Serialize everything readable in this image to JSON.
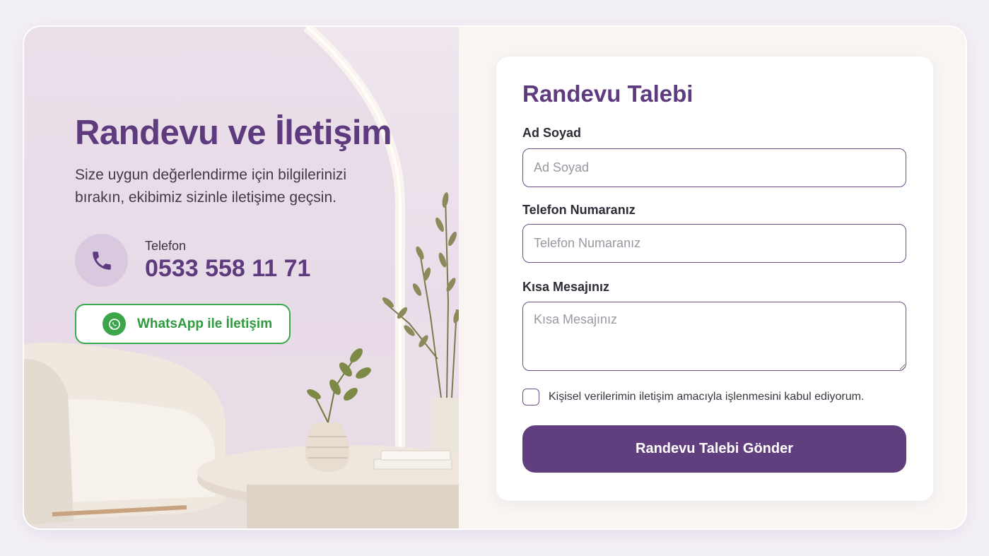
{
  "left_panel": {
    "headline": "Randevu ve İletişim",
    "subtitle": "Size uygun değerlendirme için bilgilerinizi bırakın, ekibimiz sizinle iletişime geçsin.",
    "phone": {
      "icon": "phone-icon",
      "label": "Telefon",
      "number": "0533 558 11 71"
    },
    "whatsapp_button": {
      "icon": "whatsapp-icon",
      "label": "WhatsApp ile İletişim"
    }
  },
  "form": {
    "title": "Randevu Talebi",
    "fields": [
      {
        "label": "Ad Soyad",
        "placeholder": "Ad Soyad",
        "value": ""
      },
      {
        "label": "Telefon Numaranız",
        "placeholder": "Telefon Numaranız",
        "value": ""
      },
      {
        "label": "Kısa Mesajınız",
        "placeholder": "Kısa Mesajınız",
        "value": ""
      }
    ],
    "consent": {
      "checked": false,
      "text": "Kişisel verilerimin iletişim amacıyla işlenmesini kabul ediyorum."
    },
    "submit_label": "Randevu Talebi Gönder"
  },
  "colors": {
    "brand_purple": "#5e3a7e",
    "button_purple": "#613f7f",
    "whatsapp_green": "#3aa84c",
    "page_background": "#f3eff6"
  }
}
